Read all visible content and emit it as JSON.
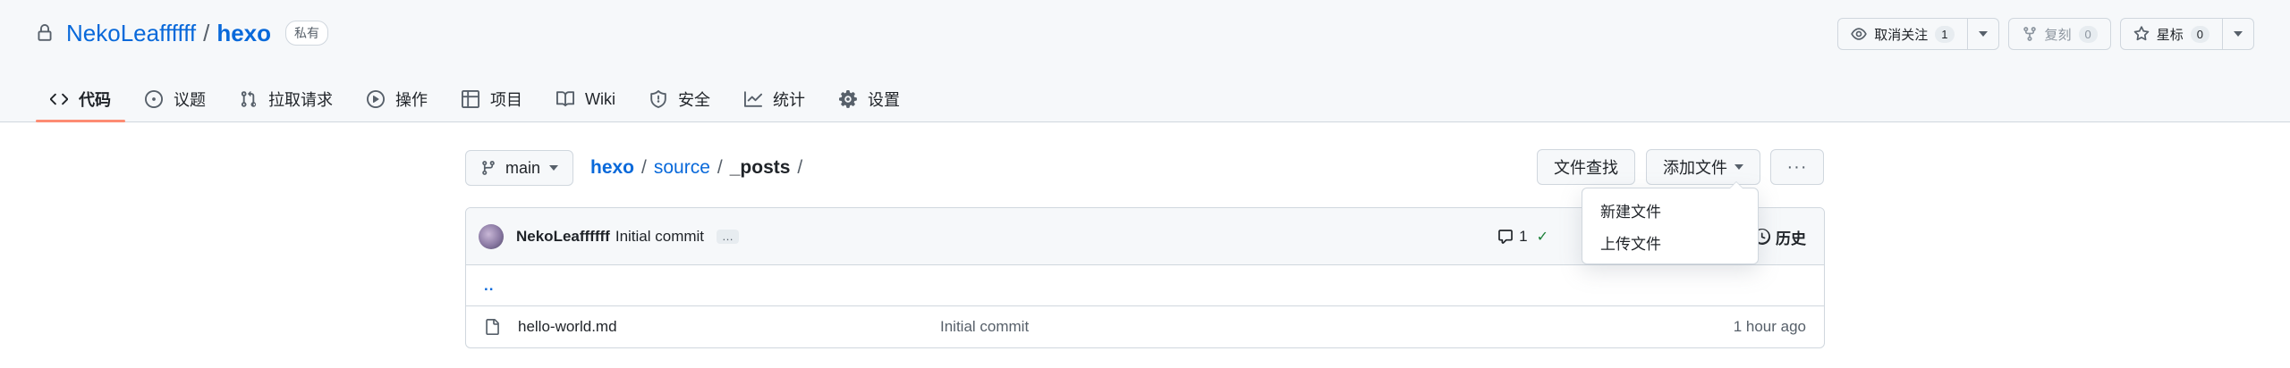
{
  "repo": {
    "owner": "NekoLeaffffff",
    "separator": "/",
    "name": "hexo",
    "visibility": "私有"
  },
  "actions": {
    "watch": {
      "label": "取消关注",
      "count": "1"
    },
    "fork": {
      "label": "复刻",
      "count": "0"
    },
    "star": {
      "label": "星标",
      "count": "0"
    }
  },
  "nav": {
    "tabs": [
      {
        "label": "代码",
        "icon": "code-icon",
        "selected": true
      },
      {
        "label": "议题",
        "icon": "issue-icon"
      },
      {
        "label": "拉取请求",
        "icon": "pull-request-icon"
      },
      {
        "label": "操作",
        "icon": "play-icon"
      },
      {
        "label": "项目",
        "icon": "table-icon"
      },
      {
        "label": "Wiki",
        "icon": "book-icon"
      },
      {
        "label": "安全",
        "icon": "shield-icon"
      },
      {
        "label": "统计",
        "icon": "graph-icon"
      },
      {
        "label": "设置",
        "icon": "gear-icon"
      }
    ]
  },
  "branch": {
    "name": "main"
  },
  "breadcrumb": {
    "root": "hexo",
    "folder": "source",
    "current": "_posts",
    "sep": "/"
  },
  "toolbar": {
    "find_label": "文件查找",
    "add_label": "添加文件",
    "more_label": "···"
  },
  "add_menu": {
    "items": [
      "新建文件",
      "上传文件"
    ]
  },
  "commit": {
    "author": "NekoLeaffffff",
    "message": "Initial commit",
    "ellipsis": "…",
    "comments": "1",
    "check": "✓",
    "history_label": "历史"
  },
  "files": {
    "up": "..",
    "rows": [
      {
        "name": "hello-world.md",
        "message": "Initial commit",
        "age": "1 hour ago"
      }
    ]
  },
  "colors": {
    "link": "#0969da",
    "tab_underline": "#fd8c73",
    "border": "#d0d7de",
    "header_bg": "#f6f8fa"
  }
}
